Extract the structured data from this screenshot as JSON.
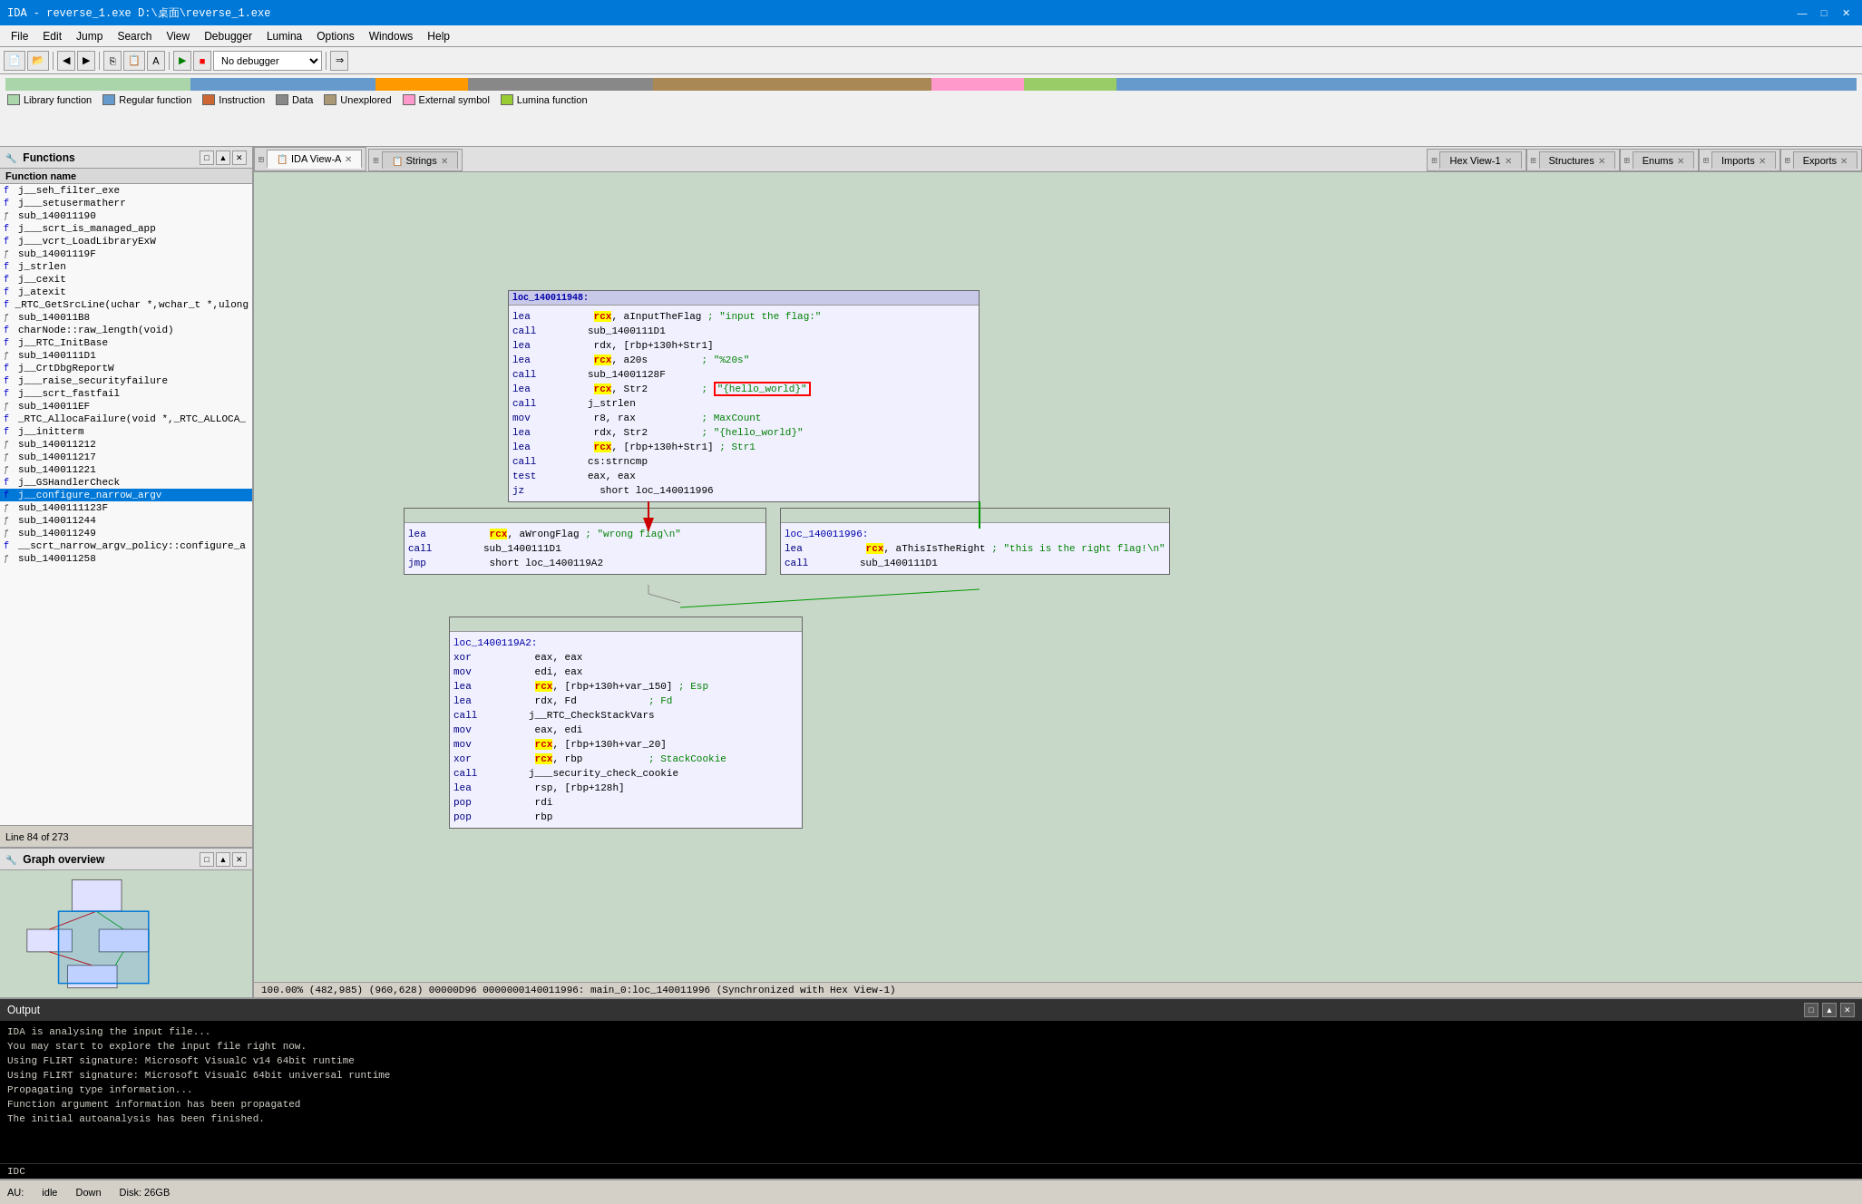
{
  "window": {
    "title": "IDA - reverse_1.exe D:\\桌面\\reverse_1.exe",
    "min_btn": "—",
    "max_btn": "□",
    "close_btn": "✕"
  },
  "menu": {
    "items": [
      "File",
      "Edit",
      "Jump",
      "Search",
      "View",
      "Debugger",
      "Lumina",
      "Options",
      "Windows",
      "Help"
    ]
  },
  "toolbar": {
    "debugger_select": "No debugger"
  },
  "legend": {
    "items": [
      {
        "label": "Library function",
        "color": "#aad4aa"
      },
      {
        "label": "Regular function",
        "color": "#6699cc"
      },
      {
        "label": "Instruction",
        "color": "#cc6633"
      },
      {
        "label": "Data",
        "color": "#888888"
      },
      {
        "label": "Unexplored",
        "color": "#aa9977"
      },
      {
        "label": "External symbol",
        "color": "#ff99cc"
      },
      {
        "label": "Lumina function",
        "color": "#99cc33"
      }
    ]
  },
  "functions_panel": {
    "title": "Functions",
    "column_header": "Function name",
    "items": [
      {
        "name": "j__seh_filter_exe",
        "type": "f"
      },
      {
        "name": "j___setusermatherr",
        "type": "f"
      },
      {
        "name": "sub_140011190",
        "type": "s"
      },
      {
        "name": "j___scrt_is_managed_app",
        "type": "f"
      },
      {
        "name": "j___vcrt_LoadLibraryExW",
        "type": "f"
      },
      {
        "name": "sub_14001119F",
        "type": "s"
      },
      {
        "name": "j_strlen",
        "type": "f"
      },
      {
        "name": "j__cexit",
        "type": "f"
      },
      {
        "name": "j_atexit",
        "type": "f"
      },
      {
        "name": "_RTC_GetSrcLine(uchar *,wchar_t *,ulong",
        "type": "f"
      },
      {
        "name": "sub_140011B8",
        "type": "s"
      },
      {
        "name": "charNode::raw_length(void)",
        "type": "f"
      },
      {
        "name": "j__RTC_InitBase",
        "type": "f"
      },
      {
        "name": "sub_1400111D1",
        "type": "s"
      },
      {
        "name": "j__CrtDbgReportW",
        "type": "f"
      },
      {
        "name": "j___raise_securityfailure",
        "type": "f"
      },
      {
        "name": "j___scrt_fastfail",
        "type": "f"
      },
      {
        "name": "sub_140011EF",
        "type": "s"
      },
      {
        "name": "_RTC_AllocaFailure(void *,_RTC_ALLOCA_",
        "type": "f"
      },
      {
        "name": "j__initterm",
        "type": "f"
      },
      {
        "name": "sub_140011212",
        "type": "s"
      },
      {
        "name": "sub_140011217",
        "type": "s"
      },
      {
        "name": "sub_140011221",
        "type": "s"
      },
      {
        "name": "j__GSHandlerCheck",
        "type": "f"
      },
      {
        "name": "j__configure_narrow_argv",
        "type": "f"
      },
      {
        "name": "sub_1400111123F",
        "type": "s"
      },
      {
        "name": "sub_140011244",
        "type": "s"
      },
      {
        "name": "sub_140011249",
        "type": "s"
      },
      {
        "name": "__scrt_narrow_argv_policy::configure_a",
        "type": "f"
      },
      {
        "name": "sub_140011258",
        "type": "s"
      }
    ],
    "line_count": "Line 84 of 273"
  },
  "tabs": {
    "left_tabs": [
      {
        "label": "IDA View-A",
        "active": false,
        "closeable": true
      },
      {
        "label": "Strings",
        "active": false,
        "closeable": true
      }
    ],
    "right_tabs": [
      {
        "label": "Hex View-1",
        "active": false,
        "closeable": true
      },
      {
        "label": "Structures",
        "active": false,
        "closeable": true
      },
      {
        "label": "Enums",
        "active": false,
        "closeable": true
      },
      {
        "label": "Imports",
        "active": false,
        "closeable": true
      },
      {
        "label": "Exports",
        "active": false,
        "closeable": true
      }
    ]
  },
  "main_block": {
    "label": "loc_140011948",
    "lines": [
      {
        "mnem": "lea",
        "ops": "rcx, aInputTheFlag",
        "comment": "; \"input the flag:\""
      },
      {
        "mnem": "call",
        "ops": "sub_1400111D1"
      },
      {
        "mnem": "lea",
        "ops": "rdx, [rbp+130h+Str1]"
      },
      {
        "mnem": "lea",
        "ops": "rcx, a20s",
        "comment": "; \"%20s\""
      },
      {
        "mnem": "call",
        "ops": "sub_14001128F"
      },
      {
        "mnem": "lea",
        "ops": "rcx, Str2",
        "comment": "; \"{hello_world}\"",
        "highlight": true
      },
      {
        "mnem": "call",
        "ops": "j_strlen"
      },
      {
        "mnem": "mov",
        "ops": "r8, rax",
        "comment": "; MaxCount"
      },
      {
        "mnem": "lea",
        "ops": "rdx, Str2",
        "comment": "; \"{hello_world}\""
      },
      {
        "mnem": "lea",
        "ops": "rcx, [rbp+130h+Str1]",
        "comment": "; Str1"
      },
      {
        "mnem": "call",
        "ops": "cs:strncmp"
      },
      {
        "mnem": "test",
        "ops": "eax, eax"
      },
      {
        "mnem": "jz",
        "ops": "short loc_140011996"
      }
    ]
  },
  "wrong_block": {
    "label": "",
    "lines": [
      {
        "mnem": "lea",
        "ops": "rcx, aWrongFlag",
        "comment": "; \"wrong flag\\n\""
      },
      {
        "mnem": "call",
        "ops": "sub_1400111D1"
      },
      {
        "mnem": "jmp",
        "ops": "short loc_1400119A2"
      }
    ]
  },
  "right_block": {
    "label": "loc_140011996:",
    "lines": [
      {
        "mnem": "lea",
        "ops": "rcx, aThisIsTheRight",
        "comment": "; \"this is the right flag!\\n\""
      },
      {
        "mnem": "call",
        "ops": "sub_1400111D1"
      }
    ]
  },
  "bottom_block": {
    "label": "loc_1400119A2:",
    "lines": [
      {
        "mnem": "xor",
        "ops": "eax, eax"
      },
      {
        "mnem": "mov",
        "ops": "edi, eax"
      },
      {
        "mnem": "lea",
        "ops": "rcx, [rbp+130h+var_150]",
        "comment": "; Esp"
      },
      {
        "mnem": "lea",
        "ops": "rdx, Fd",
        "comment": "; Fd"
      },
      {
        "mnem": "call",
        "ops": "j__RTC_CheckStackVars"
      },
      {
        "mnem": "mov",
        "ops": "eax, edi"
      },
      {
        "mnem": "mov",
        "ops": "rcx, [rbp+130h+var_20]"
      },
      {
        "mnem": "xor",
        "ops": "rcx, rbp",
        "comment": "; StackCookie"
      },
      {
        "mnem": "call",
        "ops": "j___security_check_cookie"
      },
      {
        "mnem": "lea",
        "ops": "rsp, [rbp+128h]"
      },
      {
        "mnem": "pop",
        "ops": "rdi"
      },
      {
        "mnem": "pop",
        "ops": "rbp"
      }
    ]
  },
  "coord_bar": {
    "text": "100.00% (482,985) (960,628) 00000D96 0000000140011996: main_0:loc_140011996 (Synchronized with Hex View-1)"
  },
  "graph_overview": {
    "title": "Graph overview"
  },
  "output": {
    "title": "Output",
    "lines": [
      "IDA is analysing the input file...",
      "You may start to explore the input file right now.",
      "Using FLIRT signature: Microsoft VisualC v14 64bit runtime",
      "Using FLIRT signature: Microsoft VisualC 64bit universal runtime",
      "Propagating type information...",
      "Function argument information has been propagated",
      "The initial autoanalysis has been finished."
    ],
    "input_label": "IDC",
    "input_prompt": "AU:"
  },
  "bottom_status": {
    "au": "AU:",
    "state": "idle",
    "direction": "Down",
    "disk": "Disk: 26GB"
  }
}
